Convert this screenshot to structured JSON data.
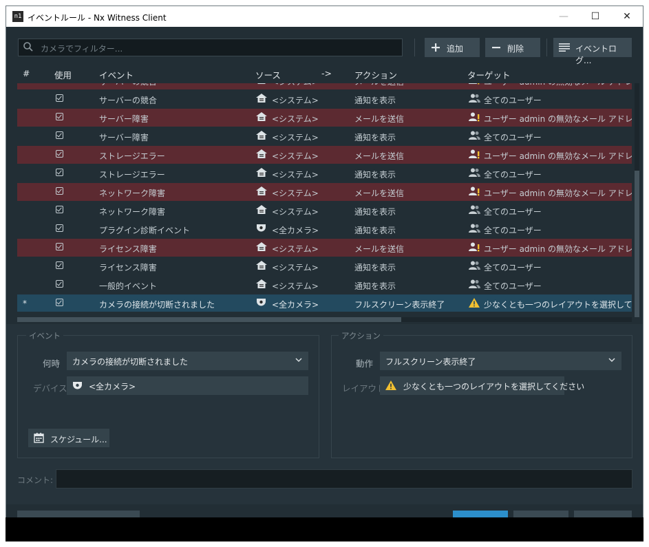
{
  "window": {
    "title": "イベントルール - Nx Witness Client",
    "logo": "n1",
    "controls": {
      "minimize": "—",
      "maximize": "☐",
      "close": "✕"
    }
  },
  "toolbar": {
    "filter_placeholder": "カメラでフィルター...",
    "add_label": "追加",
    "delete_label": "削除",
    "event_log_label": "イベントログ..."
  },
  "table": {
    "columns": {
      "num": "#",
      "enabled": "使用",
      "event": "イベント",
      "source": "ソース",
      "arrow": "->",
      "action": "アクション",
      "target": "ターゲット"
    },
    "rows": [
      {
        "marker": "",
        "event": "サーバーの競合",
        "source_icon": "server-icon",
        "source": "<システム>",
        "action": "メールを送信",
        "target_icon": "user-warning-icon",
        "target": "ユーザー admin の無効なメール アドレス",
        "status": "error"
      },
      {
        "marker": "",
        "event": "サーバーの競合",
        "source_icon": "server-icon",
        "source": "<システム>",
        "action": "通知を表示",
        "target_icon": "users-icon",
        "target": "全てのユーザー",
        "status": "normal"
      },
      {
        "marker": "",
        "event": "サーバー障害",
        "source_icon": "server-icon",
        "source": "<システム>",
        "action": "メールを送信",
        "target_icon": "user-warning-icon",
        "target": "ユーザー admin の無効なメール アドレス",
        "status": "error"
      },
      {
        "marker": "",
        "event": "サーバー障害",
        "source_icon": "server-icon",
        "source": "<システム>",
        "action": "通知を表示",
        "target_icon": "users-icon",
        "target": "全てのユーザー",
        "status": "normal"
      },
      {
        "marker": "",
        "event": "ストレージエラー",
        "source_icon": "server-icon",
        "source": "<システム>",
        "action": "メールを送信",
        "target_icon": "user-warning-icon",
        "target": "ユーザー admin の無効なメール アドレス",
        "status": "error"
      },
      {
        "marker": "",
        "event": "ストレージエラー",
        "source_icon": "server-icon",
        "source": "<システム>",
        "action": "通知を表示",
        "target_icon": "users-icon",
        "target": "全てのユーザー",
        "status": "normal"
      },
      {
        "marker": "",
        "event": "ネットワーク障害",
        "source_icon": "server-icon",
        "source": "<システム>",
        "action": "メールを送信",
        "target_icon": "user-warning-icon",
        "target": "ユーザー admin の無効なメール アドレス",
        "status": "error"
      },
      {
        "marker": "",
        "event": "ネットワーク障害",
        "source_icon": "server-icon",
        "source": "<システム>",
        "action": "通知を表示",
        "target_icon": "users-icon",
        "target": "全てのユーザー",
        "status": "normal"
      },
      {
        "marker": "",
        "event": "プラグイン診断イベント",
        "source_icon": "camera-icon",
        "source": "<全カメラ>",
        "action": "通知を表示",
        "target_icon": "users-icon",
        "target": "全てのユーザー",
        "status": "normal"
      },
      {
        "marker": "",
        "event": "ライセンス障害",
        "source_icon": "server-icon",
        "source": "<システム>",
        "action": "メールを送信",
        "target_icon": "user-warning-icon",
        "target": "ユーザー admin の無効なメール アドレス",
        "status": "error"
      },
      {
        "marker": "",
        "event": "ライセンス障害",
        "source_icon": "server-icon",
        "source": "<システム>",
        "action": "通知を表示",
        "target_icon": "users-icon",
        "target": "全てのユーザー",
        "status": "normal"
      },
      {
        "marker": "",
        "event": "一般的イベント",
        "source_icon": "server-icon",
        "source": "<システム>",
        "action": "通知を表示",
        "target_icon": "users-icon",
        "target": "全てのユーザー",
        "status": "normal"
      },
      {
        "marker": "*",
        "event": "カメラの接続が切断されました",
        "source_icon": "camera-icon",
        "source": "<全カメラ>",
        "action": "フルスクリーン表示終了",
        "target_icon": "warning-icon",
        "target": "少なくとも一つのレイアウトを選択してく...",
        "status": "selected"
      }
    ]
  },
  "event_panel": {
    "title": "イベント",
    "when_label": "何時",
    "when_value": "カメラの接続が切断されました",
    "device_label": "デバイス",
    "device_value": "<全カメラ>",
    "schedule_label": "スケジュール..."
  },
  "action_panel": {
    "title": "アクション",
    "action_label": "動作",
    "action_value": "フルスクリーン表示終了",
    "layout_label": "レイアウト",
    "layout_value": "少なくとも一つのレイアウトを選択してください"
  },
  "comment": {
    "label": "コメント:",
    "value": ""
  },
  "colors": {
    "error_row": "#5c2a31",
    "selected_row": "#234a5f",
    "warning": "#f2c031",
    "primary": "#2c8fcb"
  }
}
